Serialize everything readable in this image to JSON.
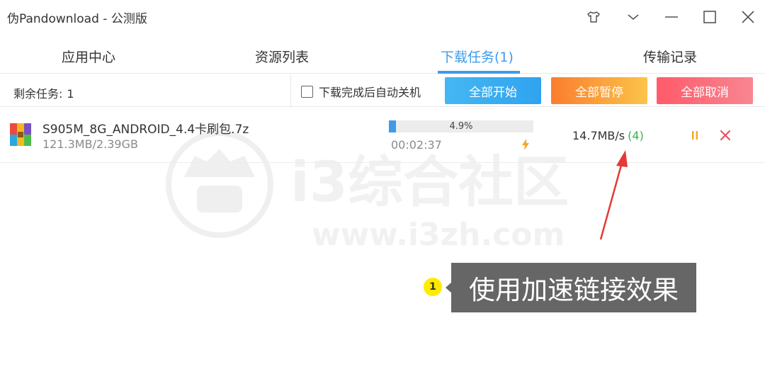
{
  "window": {
    "title": "伪Pandownload - 公测版",
    "controls": [
      "skin-icon",
      "dropdown-icon",
      "minimize-icon",
      "maximize-icon",
      "close-icon"
    ]
  },
  "tabs": [
    {
      "label": "应用中心",
      "active": false
    },
    {
      "label": "资源列表",
      "active": false
    },
    {
      "label": "下载任务(1)",
      "active": true
    },
    {
      "label": "传输记录",
      "active": false
    }
  ],
  "toolbar": {
    "remaining_label": "剩余任务:",
    "remaining_count": "1",
    "auto_shutdown_label": "下载完成后自动关机",
    "auto_shutdown_checked": false,
    "start_all": "全部开始",
    "pause_all": "全部暂停",
    "cancel_all": "全部取消"
  },
  "download": {
    "file_icon": "archive-icon",
    "filename": "S905M_8G_ANDROID_4.4卡刷包.7z",
    "size": "121.3MB/2.39GB",
    "progress_percent": 4.9,
    "progress_text": "4.9%",
    "eta": "00:02:37",
    "speed": "14.7MB/s",
    "connections": "(4)",
    "accent": "#3d9be9"
  },
  "watermark": {
    "text": "i3综合社区",
    "url": "www.i3zh.com"
  },
  "annotation": {
    "number": "1",
    "text": "使用加速链接效果"
  }
}
